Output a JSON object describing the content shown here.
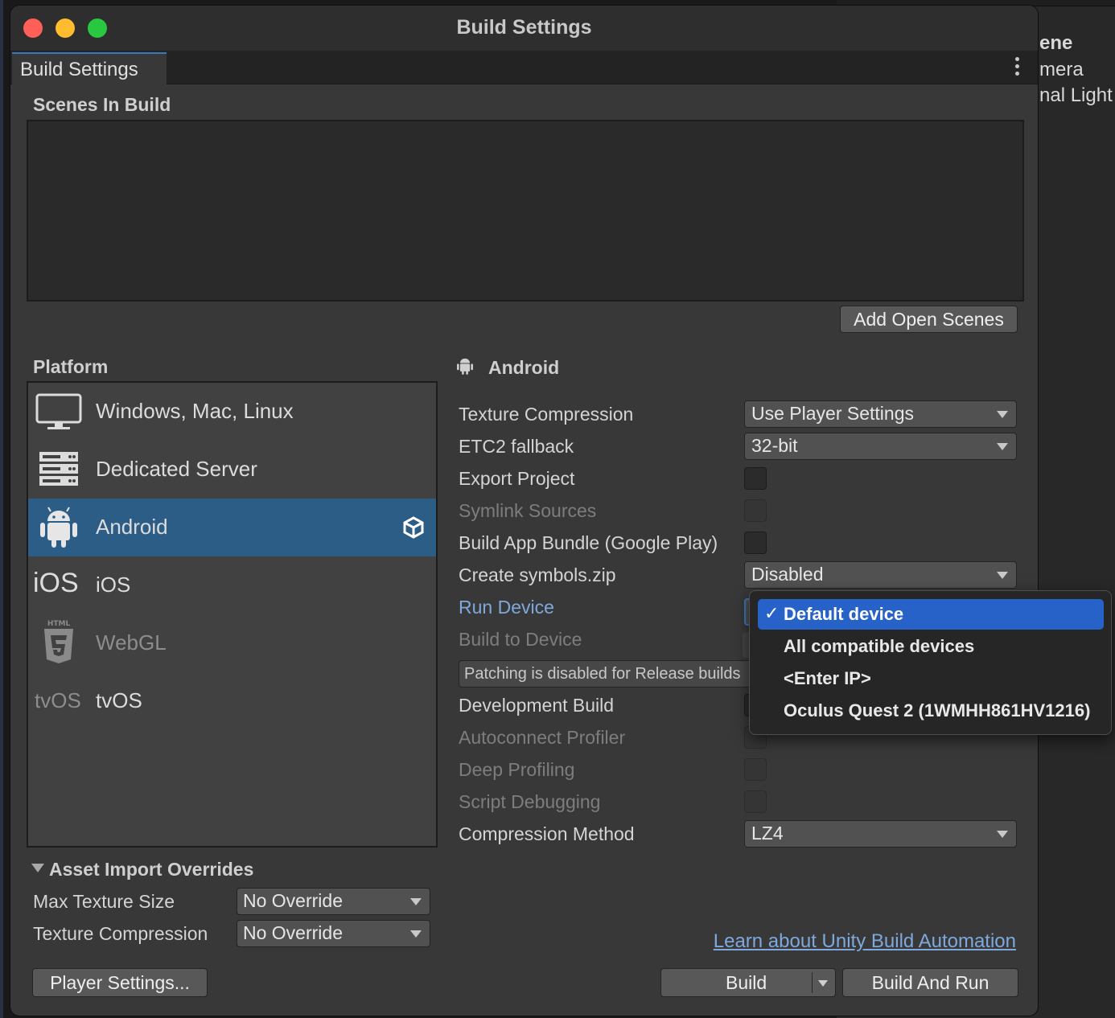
{
  "window": {
    "title": "Build Settings",
    "tab": "Build Settings"
  },
  "background_hierarchy": {
    "items": [
      "ene",
      "mera",
      "nal Light"
    ]
  },
  "scenes": {
    "label": "Scenes In Build",
    "add_button": "Add Open Scenes"
  },
  "platform": {
    "label": "Platform",
    "items": [
      {
        "label": "Windows, Mac, Linux",
        "icon": "monitor-icon",
        "selected": false,
        "dim": false
      },
      {
        "label": "Dedicated Server",
        "icon": "server-icon",
        "selected": false,
        "dim": false
      },
      {
        "label": "Android",
        "icon": "android-icon",
        "selected": true,
        "dim": false
      },
      {
        "label": "iOS",
        "icon": "ios-icon",
        "selected": false,
        "dim": false
      },
      {
        "label": "WebGL",
        "icon": "html5-icon",
        "selected": false,
        "dim": true
      },
      {
        "label": "tvOS",
        "icon": "tvos-icon",
        "selected": false,
        "dim": false
      }
    ],
    "ios_icon_text": "iOS",
    "tvos_icon_text": "tvOS",
    "html5_icon_text": "HTML"
  },
  "android_settings": {
    "header": "Android",
    "texture_compression": {
      "label": "Texture Compression",
      "value": "Use Player Settings"
    },
    "etc2_fallback": {
      "label": "ETC2 fallback",
      "value": "32-bit"
    },
    "export_project": {
      "label": "Export Project",
      "checked": false
    },
    "symlink_sources": {
      "label": "Symlink Sources",
      "checked": false
    },
    "build_app_bundle": {
      "label": "Build App Bundle (Google Play)",
      "checked": false
    },
    "create_symbols": {
      "label": "Create symbols.zip",
      "value": "Disabled"
    },
    "run_device": {
      "label": "Run Device"
    },
    "build_to_device": {
      "label": "Build to Device"
    },
    "patching_note": "Patching is disabled for Release builds",
    "development_build": {
      "label": "Development Build"
    },
    "autoconnect_profiler": {
      "label": "Autoconnect Profiler"
    },
    "deep_profiling": {
      "label": "Deep Profiling"
    },
    "script_debugging": {
      "label": "Script Debugging"
    },
    "compression_method": {
      "label": "Compression Method",
      "value": "LZ4"
    }
  },
  "run_device_menu": {
    "checkmark": "✓",
    "items": [
      "Default device",
      "All compatible devices",
      "<Enter IP>",
      "Oculus Quest 2 (1WMHH861HV1216)"
    ],
    "selected_index": 0
  },
  "asset_import_overrides": {
    "label": "Asset Import Overrides",
    "max_texture_size": {
      "label": "Max Texture Size",
      "value": "No Override"
    },
    "texture_compression": {
      "label": "Texture Compression",
      "value": "No Override"
    }
  },
  "footer": {
    "player_settings": "Player Settings...",
    "learn_link": "Learn about Unity Build Automation",
    "build": "Build",
    "build_and_run": "Build And Run"
  },
  "colors": {
    "accent": "#2c5d87",
    "menu_highlight": "#2762c9",
    "link": "#7fa8dd"
  }
}
